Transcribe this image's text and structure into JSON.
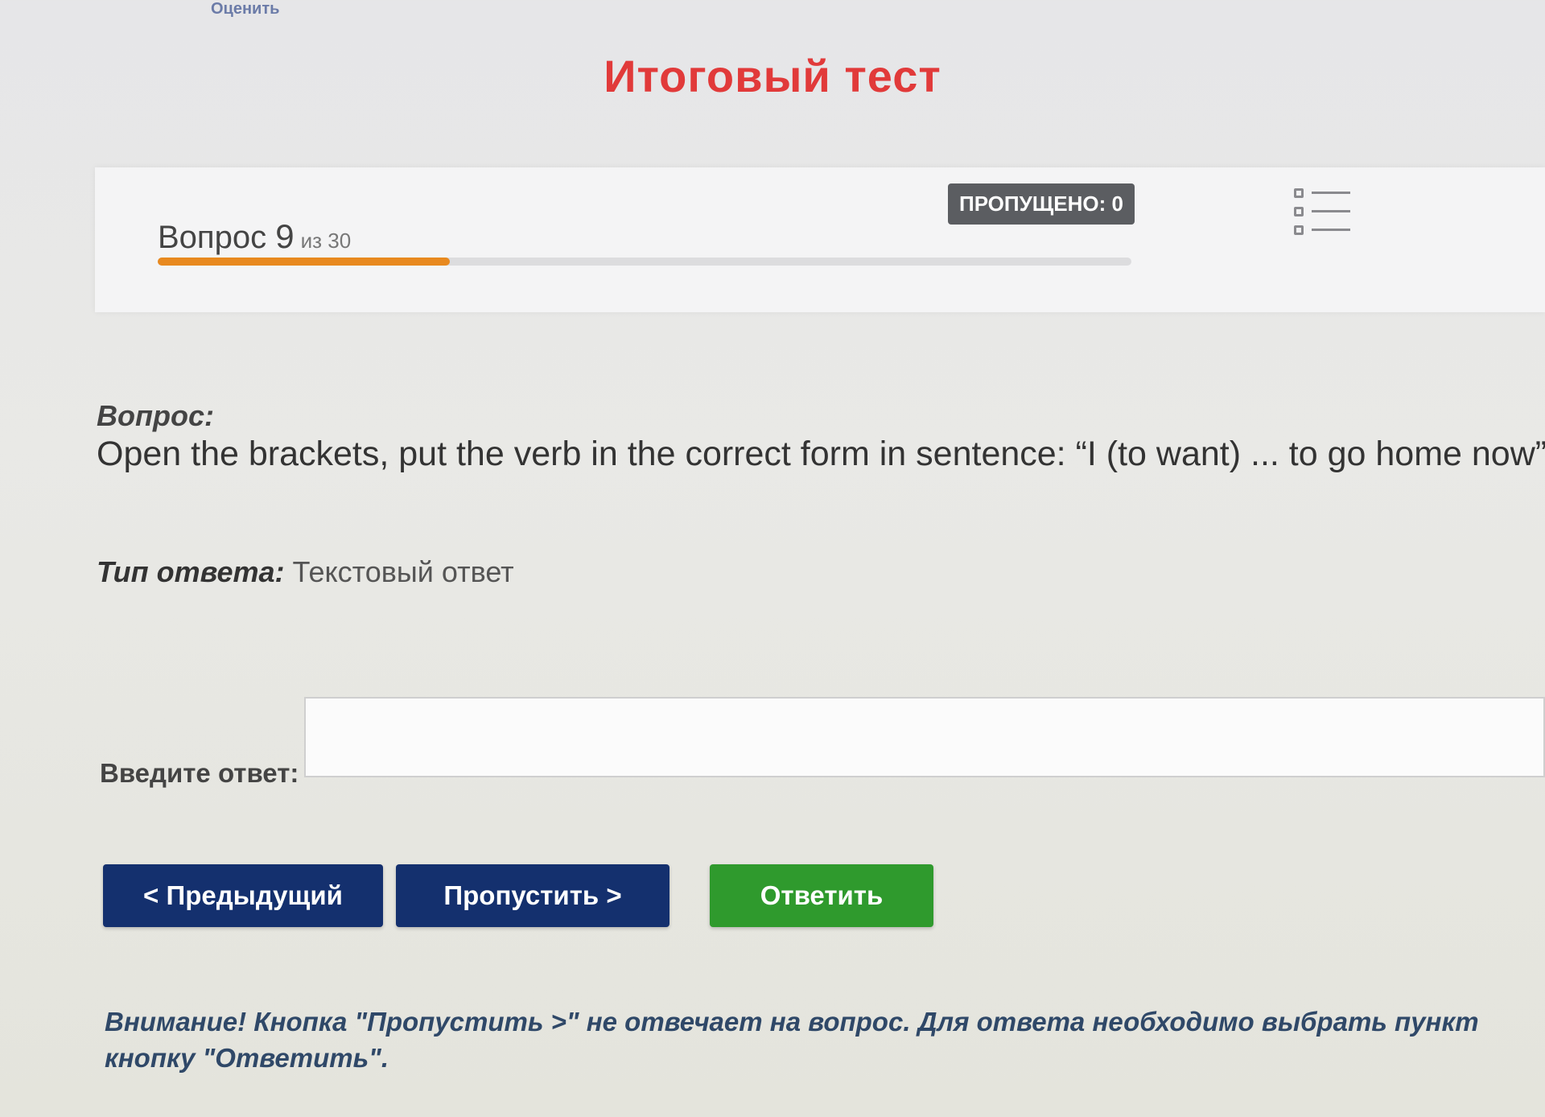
{
  "header": {
    "top_link": "Оценить",
    "title": "Итоговый тест"
  },
  "progress": {
    "question_label": "Вопрос",
    "current": "9",
    "of_label": "из 30",
    "fraction_complete": 0.3,
    "skipped_badge": "ПРОПУЩЕНО: 0",
    "question_list_icon": "question-list-icon"
  },
  "question": {
    "label": "Вопрос:",
    "text": "Open the brackets, put the verb in the correct form in sentence: “I (to want) ... to go home now”"
  },
  "answer_type": {
    "label": "Тип ответа:",
    "value": "Текстовый ответ"
  },
  "answer": {
    "label": "Введите ответ:",
    "value": ""
  },
  "buttons": {
    "prev": "< Предыдущий",
    "skip": "Пропустить >",
    "submit": "Ответить"
  },
  "colors": {
    "title": "#e13a3a",
    "progress": "#e8891f",
    "nav_button": "#14306e",
    "submit_button": "#2f9a2d"
  },
  "warning": "Внимание! Кнопка \"Пропустить >\" не отвечает на вопрос. Для ответа необходимо выбрать пункт кнопку \"Ответить\"."
}
